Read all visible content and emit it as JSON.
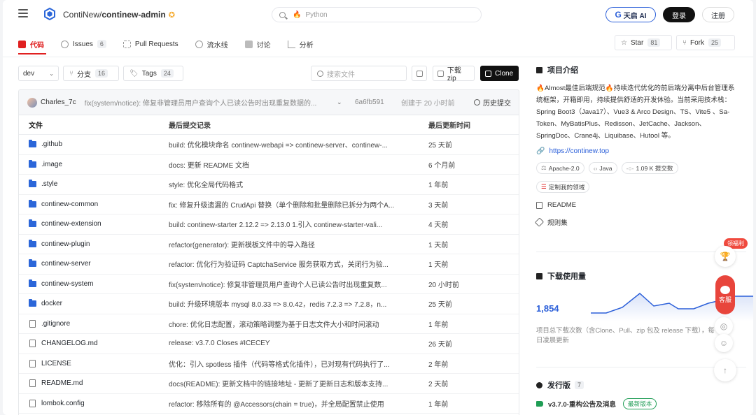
{
  "header": {
    "repo_owner": "ContiNew/",
    "repo_name": "continew-admin",
    "search_placeholder": "Python",
    "ai_label": "天启 AI",
    "login_label": "登录",
    "register_label": "注册"
  },
  "tabs": [
    {
      "label": "代码",
      "count": ""
    },
    {
      "label": "Issues",
      "count": "6"
    },
    {
      "label": "Pull Requests",
      "count": ""
    },
    {
      "label": "流水线",
      "count": ""
    },
    {
      "label": "讨论",
      "count": ""
    },
    {
      "label": "分析",
      "count": ""
    }
  ],
  "repo_actions": {
    "star_label": "Star",
    "star_count": "81",
    "fork_label": "Fork",
    "fork_count": "25"
  },
  "toolbar": {
    "branch": "dev",
    "branches_label": "分支",
    "branches_count": "16",
    "tags_label": "Tags",
    "tags_count": "24",
    "file_search_placeholder": "搜索文件",
    "zip_label": "下载zip",
    "clone_label": "Clone"
  },
  "latest_commit": {
    "author": "Charles_7c",
    "message": "fix(system/notice): 修复非管理员用户查询个人已读公告时出现重复数据的...",
    "hash": "6a6fb591",
    "time": "创建于 20 小时前",
    "history_label": "历史提交"
  },
  "table": {
    "headers": [
      "文件",
      "最后提交记录",
      "最后更新时间"
    ],
    "rows": [
      {
        "type": "dir",
        "name": ".github",
        "commit": "build: 优化模块命名 continew-webapi => continew-server、continew-...",
        "time": "25 天前"
      },
      {
        "type": "dir",
        "name": ".image",
        "commit": "docs: 更新 README 文档",
        "time": "6 个月前"
      },
      {
        "type": "dir",
        "name": ".style",
        "commit": "style: 优化全局代码格式",
        "time": "1 年前"
      },
      {
        "type": "dir",
        "name": "continew-common",
        "commit": "fix: 修复升级遗漏的 CrudApi 替换（单个删除和批量删除已拆分为两个A...",
        "time": "3 天前"
      },
      {
        "type": "dir",
        "name": "continew-extension",
        "commit": "build: continew-starter 2.12.2 => 2.13.0 1.引入 continew-starter-vali...",
        "time": "4 天前"
      },
      {
        "type": "dir",
        "name": "continew-plugin",
        "commit": "refactor(generator): 更新模板文件中的导入路径",
        "time": "1 天前"
      },
      {
        "type": "dir",
        "name": "continew-server",
        "commit": "refactor: 优化行为验证码 CaptchaService 服务获取方式，关闭行为验...",
        "time": "1 天前"
      },
      {
        "type": "dir",
        "name": "continew-system",
        "commit": "fix(system/notice): 修复非管理员用户查询个人已读公告时出现重复数...",
        "time": "20 小时前"
      },
      {
        "type": "dir",
        "name": "docker",
        "commit": "build: 升级环境版本 mysql 8.0.33 => 8.0.42，redis 7.2.3 => 7.2.8，n...",
        "time": "25 天前"
      },
      {
        "type": "file",
        "name": ".gitignore",
        "commit": "chore: 优化日志配置，滚动策略调整为基于日志文件大小和时间滚动",
        "time": "1 年前"
      },
      {
        "type": "file",
        "name": "CHANGELOG.md",
        "commit": "release: v3.7.0 Closes #ICECEY",
        "time": "26 天前"
      },
      {
        "type": "file",
        "name": "LICENSE",
        "commit": "优化：引入 spotless 插件（代码等格式化插件），已对现有代码执行了...",
        "time": "2 年前"
      },
      {
        "type": "file",
        "name": "README.md",
        "commit": "docs(README): 更新文档中的链接地址 - 更新了更新日志和版本支持...",
        "time": "2 天前"
      },
      {
        "type": "file",
        "name": "lombok.config",
        "commit": "refactor: 移除所有的 @Accessors(chain = true)，并全局配置禁止使用",
        "time": "1 年前"
      }
    ]
  },
  "sidebar": {
    "intro_title": "项目介绍",
    "description": "🔥Almost最佳后端规范🔥持续迭代优化的前后端分离中后台管理系统框架，开箱即用，持续提供舒适的开发体验。当前采用技术栈：Spring Boot3（Java17）、Vue3 & Arco Design、TS、Vite5 、Sa-Token、MyBatisPlus、Redisson、JetCache、Jackson、SpringDoc、Crane4j、Liquibase、Hutool 等。",
    "website": "https://continew.top",
    "pills": [
      "Apache-2.0",
      "Java",
      "1.09 K 提交数"
    ],
    "custom_label": "定制我的领域",
    "readme_label": "README",
    "rules_label": "规则集",
    "downloads_title": "下载使用量",
    "downloads_count": "1,854",
    "downloads_desc": "项目总下载次数（含Clone、Pull、zip 包及 release 下载），每日凌晨更新",
    "releases_title": "发行版",
    "releases_count": "7",
    "latest_release": "v3.7.0-重构公告及消息",
    "latest_badge": "最新版本"
  },
  "floating": {
    "welfare": "领福利",
    "service": "客服"
  },
  "colors": {
    "accent": "#e02020",
    "link": "#2b5fd9",
    "folder": "#2b66d9"
  }
}
